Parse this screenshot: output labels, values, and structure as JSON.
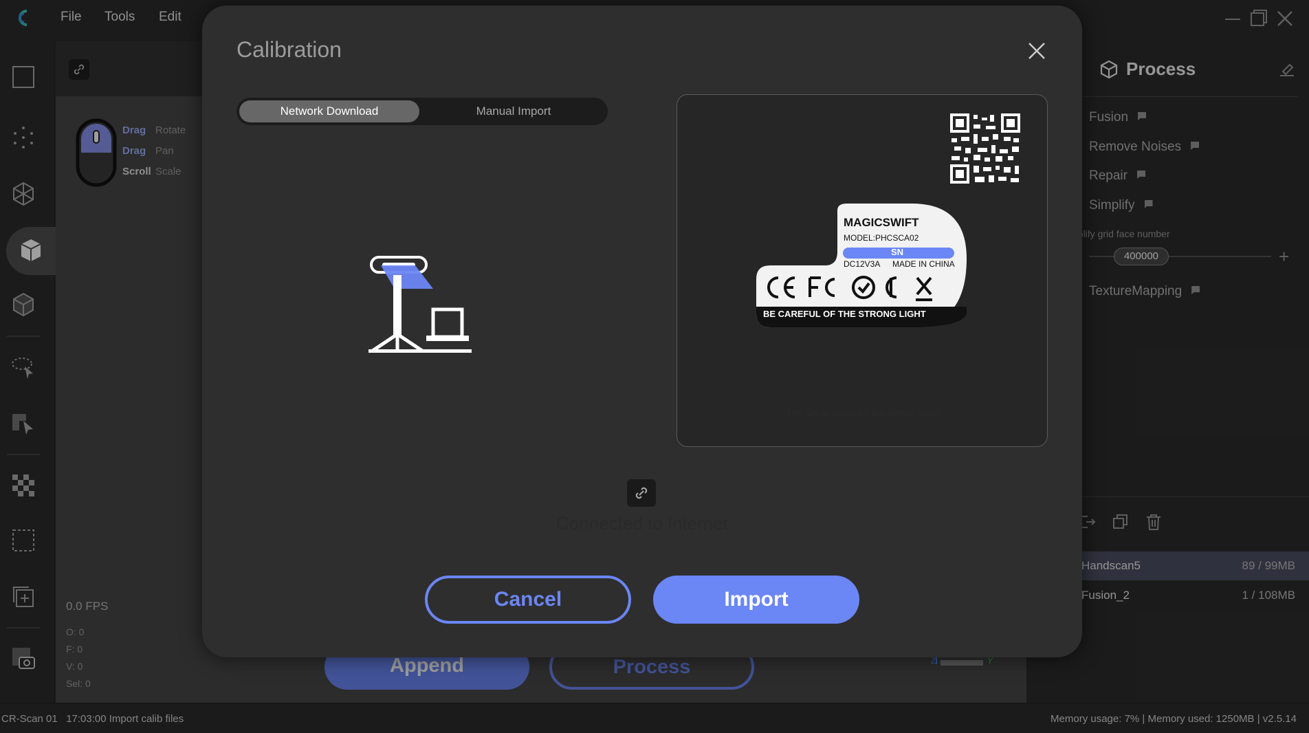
{
  "menubar": {
    "items": [
      "File",
      "Tools",
      "Edit"
    ]
  },
  "viewport": {
    "hints": [
      {
        "key": "Drag",
        "action": "Rotate"
      },
      {
        "key": "Drag",
        "action": "Pan"
      },
      {
        "key": "Scroll",
        "action": "Scale"
      }
    ],
    "fps": "0.0 FPS",
    "stats": [
      "O: 0",
      "F: 0",
      "V: 0",
      "Sel: 0"
    ],
    "append_label": "Append",
    "process_label": "Process",
    "axis_labels": {
      "z": "Z",
      "y": "Y"
    }
  },
  "rightpanel": {
    "title": "Process",
    "items": [
      "Fusion",
      "Remove Noises",
      "Repair",
      "Simplify"
    ],
    "simplify_sub": "nplify grid face number",
    "slider_value": "400000",
    "texture": "TextureMapping",
    "projects": [
      {
        "name": "Handscan5",
        "size": "89 / 99MB"
      },
      {
        "name": "Fusion_2",
        "size": "1 / 108MB"
      }
    ]
  },
  "statusbar": {
    "left": "CR-Scan 01   17:03:00 Import calib files",
    "right": "Memory usage: 7% | Memory used: 1250MB | v2.5.14"
  },
  "modal": {
    "title": "Calibration",
    "tabs": {
      "network": "Network Download",
      "manual": "Manual Import"
    },
    "label": {
      "brand": "MAGICSWIFT",
      "model": "MODEL:PHCSCA02",
      "sn": "SN",
      "power": "DC12V3A",
      "made": "MADE IN CHINA",
      "warning": "BE CAREFUL OF THE STRONG LIGHT"
    },
    "sn_note": "-The SN is found on the device label-",
    "connection": "Connected to Internet",
    "cancel": "Cancel",
    "import": "Import"
  },
  "colors": {
    "accent": "#6b86f5",
    "hint_key": "#9db0ff"
  }
}
